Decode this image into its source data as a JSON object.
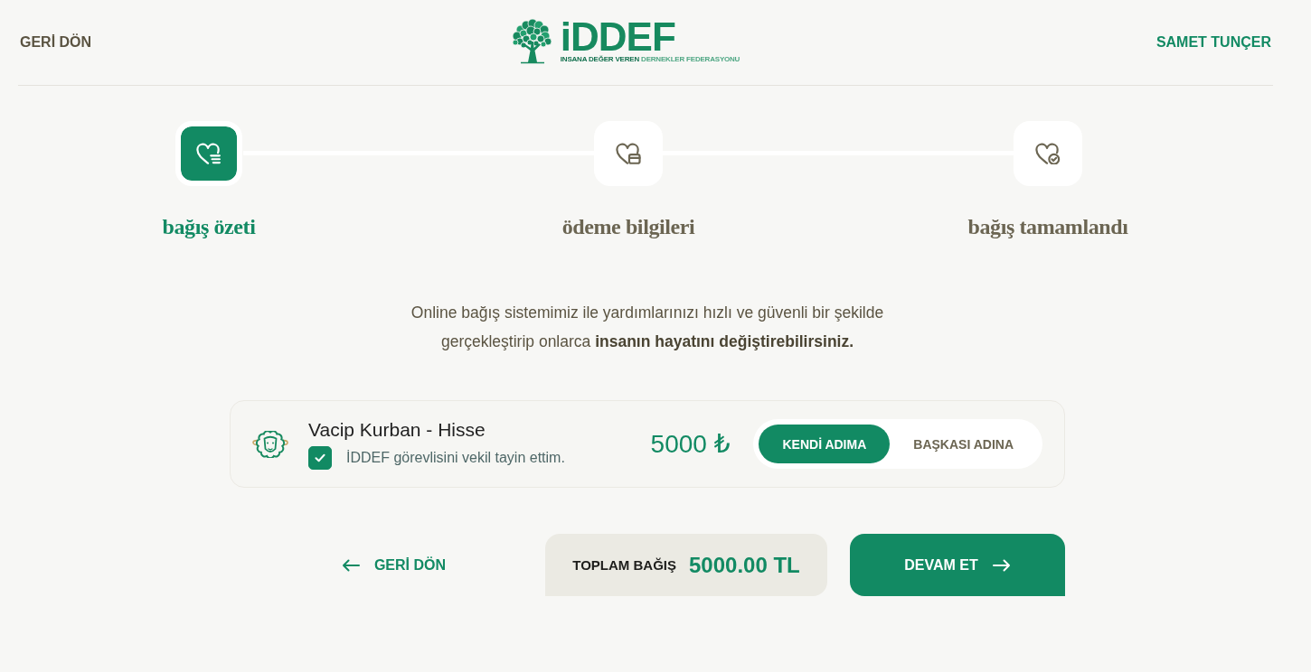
{
  "header": {
    "back_link": "GERİ DÖN",
    "logo": {
      "wordmark": "iDDEF",
      "tagline": "**INSANA DEĞER VEREN** DERNEKLER FEDERASYONU"
    },
    "user_name": "SAMET TUNÇER"
  },
  "steps": [
    {
      "label": "bağış özeti",
      "kind": "summary",
      "selected": true
    },
    {
      "label": "ödeme bilgileri",
      "kind": "payment",
      "selected": false
    },
    {
      "label": "bağış tamamlandı",
      "kind": "done",
      "selected": false
    }
  ],
  "intro": "Online bağış sistemimiz ile yardımlarınızı hızlı ve güvenli bir şekilde gerçekleştirip onlarca **insanın hayatını değiştirebilirsiniz.**",
  "donation": {
    "title": "Vacip Kurban - Hisse",
    "proxy": {
      "label": "İDDEF görevlisini vekil tayin ettim.",
      "checked": true
    },
    "amount": "5000 ₺",
    "options": [
      {
        "label": "KENDİ ADIMA",
        "selected": true
      },
      {
        "label": "BAŞKASI ADINA",
        "selected": false
      }
    ]
  },
  "footer": {
    "back_button": "GERİ DÖN",
    "total_label": "TOPLAM BAĞIŞ",
    "total_value": "5000.00 TL",
    "continue_button": "DEVAM ET"
  }
}
